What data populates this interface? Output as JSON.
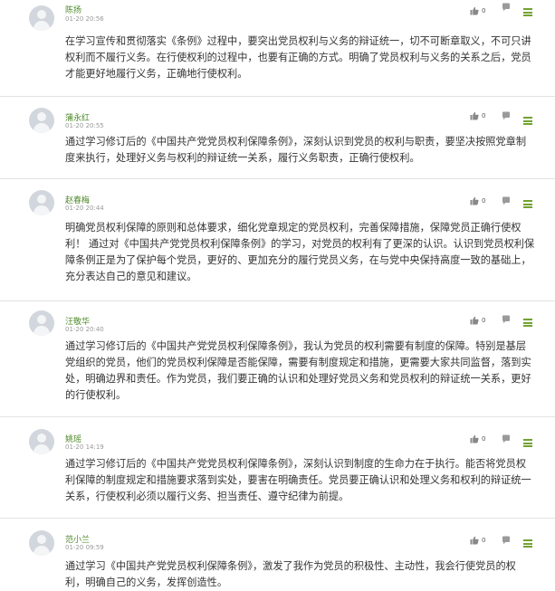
{
  "comments": [
    {
      "name": "陈扬",
      "time": "01-20 20:56",
      "likes": "0",
      "text": "在学习宣传和贯彻落实《条例》过程中，要突出党员权利与义务的辩证统一，切不可断章取义，不可只讲权利而不履行义务。在行使权利的过程中，也要有正确的方式。明确了党员权利与义务的关系之后，党员才能更好地履行义务，正确地行使权利。"
    },
    {
      "name": "蒲永红",
      "time": "01-20 20:55",
      "likes": "0",
      "text": "通过学习修订后的《中国共产党党员权利保障条例》，深刻认识到党员的权利与职责，要坚决按照党章制度来执行，处理好义务与权利的辩证统一关系，履行义务职责，正确行使权利。"
    },
    {
      "name": "赵春梅",
      "time": "01-20 20:44",
      "likes": "0",
      "text": "明确党员权利保障的原则和总体要求，细化党章规定的党员权利，完善保障措施，保障党员正确行使权利！  通过对《中国共产党党员权利保障条例》的学习，对党员的权利有了更深的认识。认识到党员权利保障条例正是为了保护每个党员，更好的、更加充分的履行党员义务，在与党中央保持高度一致的基础上，充分表达自己的意见和建议。"
    },
    {
      "name": "汪敬华",
      "time": "01-20 20:40",
      "likes": "0",
      "text": "通过学习修订后的《中国共产党党员权利保障条例》，我认为党员的权利需要有制度的保障。特别是基层党组织的党员，他们的党员权利保障是否能保障，需要有制度规定和措施，更需要大家共同监督，落到实处，明确边界和责任。作为党员，我们要正确的认识和处理好党员义务和党员权利的辩证统一关系，更好的行使权利。"
    },
    {
      "name": "姚瑶",
      "time": "01-20 14:19",
      "likes": "0",
      "text": "通过学习修订后的《中国共产党党员权利保障条例》，深刻认识到制度的生命力在于执行。能否将党员权利保障的制度规定和措施要求落到实处，要害在明确责任。党员要正确认识和处理义务和权利的辩证统一关系，行使权利必须以履行义务、担当责任、遵守纪律为前提。"
    },
    {
      "name": "范小兰",
      "time": "01-20 09:59",
      "likes": "0",
      "text": "通过学习《中国共产党党员权利保障条例》，激发了我作为党员的积极性、主动性，我会行使党员的权利，明确自己的义务，发挥创造性。"
    }
  ]
}
